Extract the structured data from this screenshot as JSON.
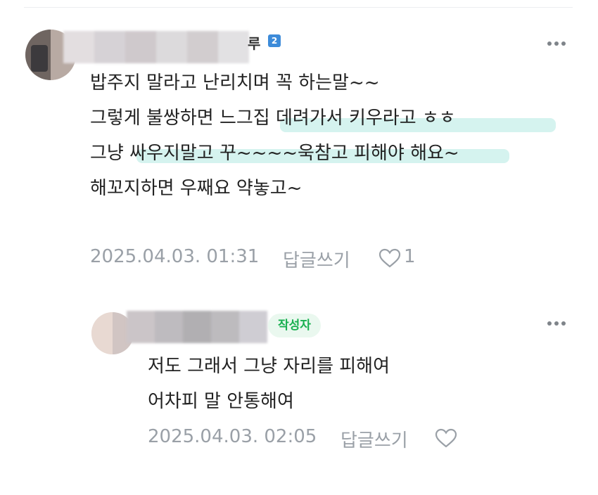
{
  "comments": [
    {
      "author_suffix": "루",
      "grade_badge": "2",
      "lines": [
        "밥주지 말라고 난리치며 꼭 하는말~~",
        "그렇게 불쌍하면 느그집 데려가서 키우라고 ㅎㅎ",
        "그냥 싸우지말고 꾸~~~~욱참고 피해야 해요~",
        "해꼬지하면 우째요 약놓고~"
      ],
      "date": "2025.04.03. 01:31",
      "reply_label": "답글쓰기",
      "like_count": "1"
    },
    {
      "badge": "작성자",
      "lines": [
        "저도 그래서 그냥 자리를 피해여",
        "어차피 말 안통해여"
      ],
      "date": "2025.04.03. 02:05",
      "reply_label": "답글쓰기",
      "like_count": ""
    }
  ],
  "colors": {
    "highlight": "#d5f3ef",
    "writer_badge_bg": "#eaf8ef",
    "writer_badge_text": "#19b050",
    "meta_text": "#9aa0a7"
  }
}
